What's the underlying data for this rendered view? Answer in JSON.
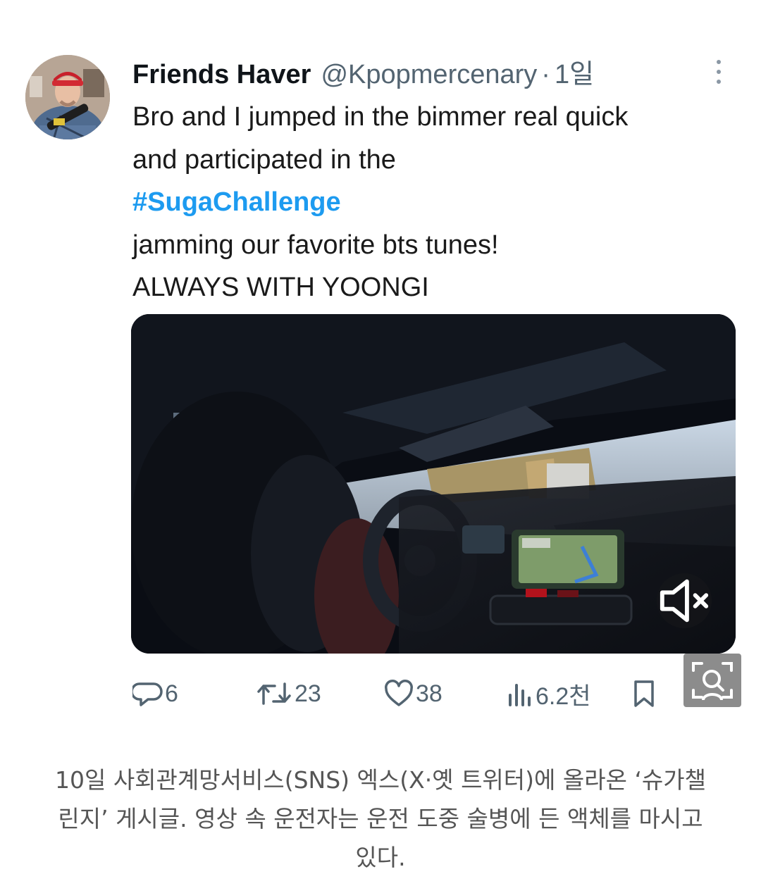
{
  "tweet": {
    "author_name": "Friends Haver",
    "handle": "@Kpopmercenary",
    "separator": "·",
    "time": "1일",
    "lines": [
      "Bro and I jumped in the bimmer real quick",
      "and participated in the"
    ],
    "hashtag": "#SugaChallenge",
    "lines_after": [
      "jamming our favorite bts tunes!",
      "ALWAYS WITH YOONGI"
    ],
    "video": {
      "muted": true,
      "icons": [
        "mute-icon"
      ]
    },
    "actions": {
      "replies": "6",
      "retweets": "23",
      "likes": "38",
      "views": "6.2천"
    }
  },
  "caption": {
    "lines": [
      "10일 사회관계망서비스(SNS) 엑스(X·옛 트위터)에 올라온 ‘슈가챌",
      "린지’ 게시글. 영상 속 운전자는 운전 도중 술병에 든 액체를 마시고",
      "있다."
    ]
  },
  "colors": {
    "hashtag": "#1d9bf0",
    "secondary_text": "#536471",
    "caption_text": "#555555"
  }
}
